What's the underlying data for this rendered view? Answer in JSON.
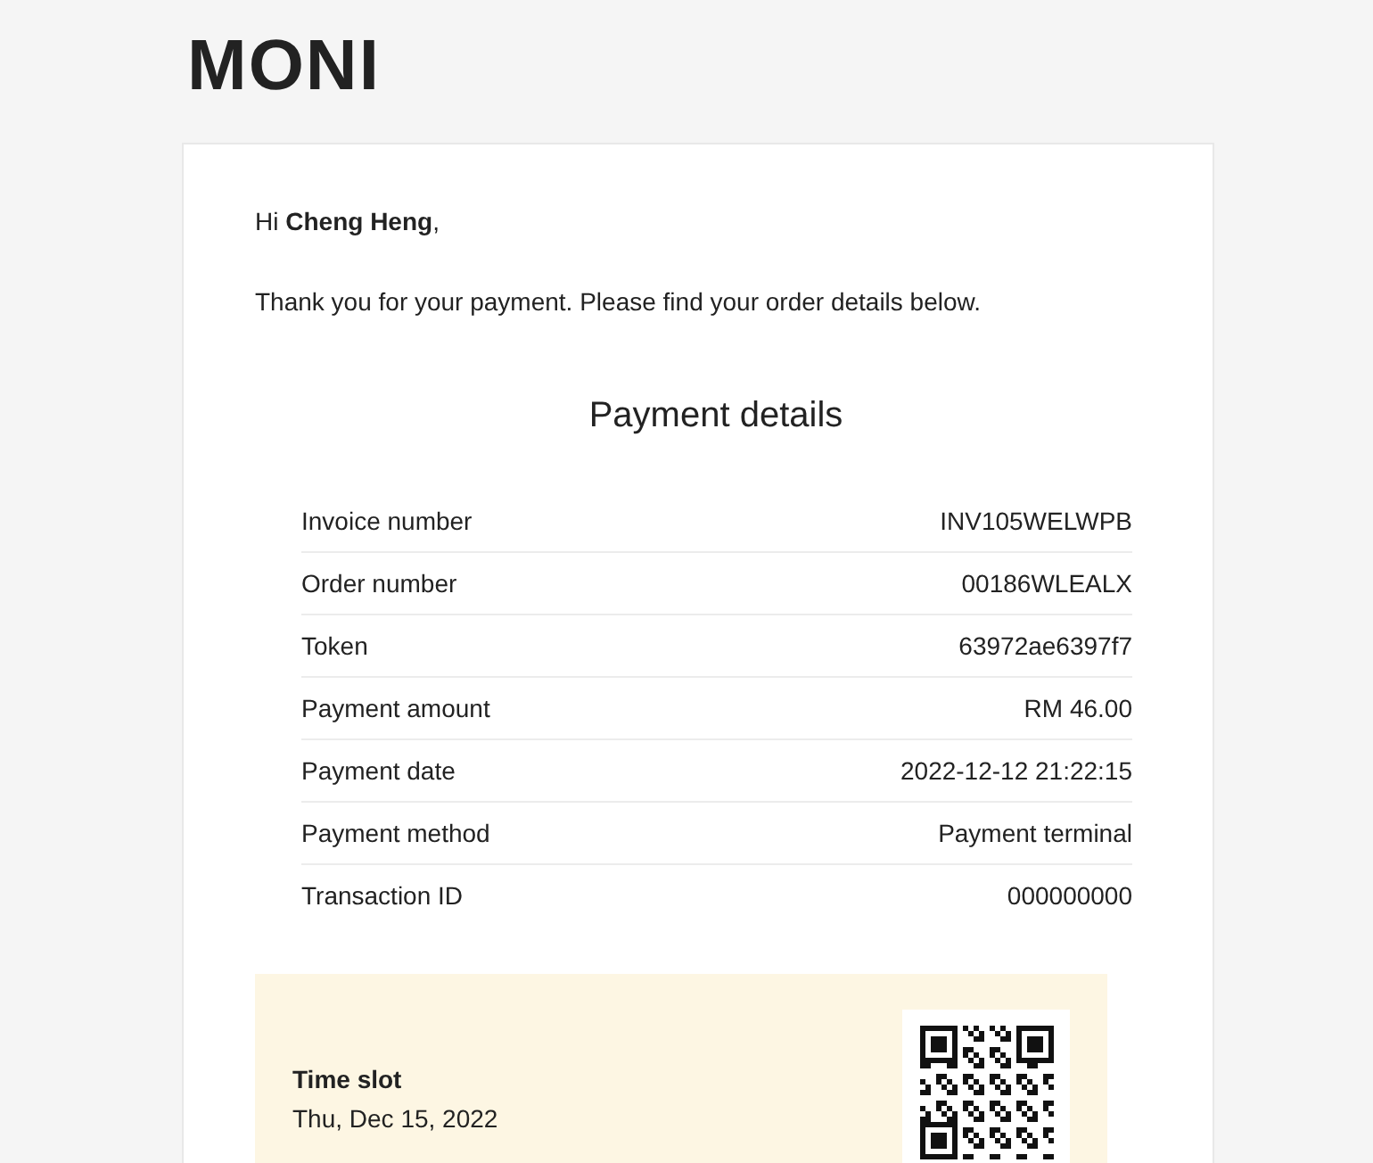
{
  "logo": "MONI",
  "greeting": "Hi **Cheng Heng**,",
  "message": "Thank you for your payment. Please find your order details below.",
  "details_title": "Payment details",
  "details": [
    {
      "label": "Invoice number",
      "value": "INV105WELWPB"
    },
    {
      "label": "Order number",
      "value": "00186WLEALX"
    },
    {
      "label": "Token",
      "value": "63972ae6397f7"
    },
    {
      "label": "Payment amount",
      "value": "RM 46.00"
    },
    {
      "label": "Payment date",
      "value": "2022-12-12 21:22:15"
    },
    {
      "label": "Payment method",
      "value": "Payment terminal"
    },
    {
      "label": "Transaction ID",
      "value": "000000000"
    }
  ],
  "time_slot": {
    "label": "Time slot",
    "date": "Thu, Dec 15, 2022"
  }
}
